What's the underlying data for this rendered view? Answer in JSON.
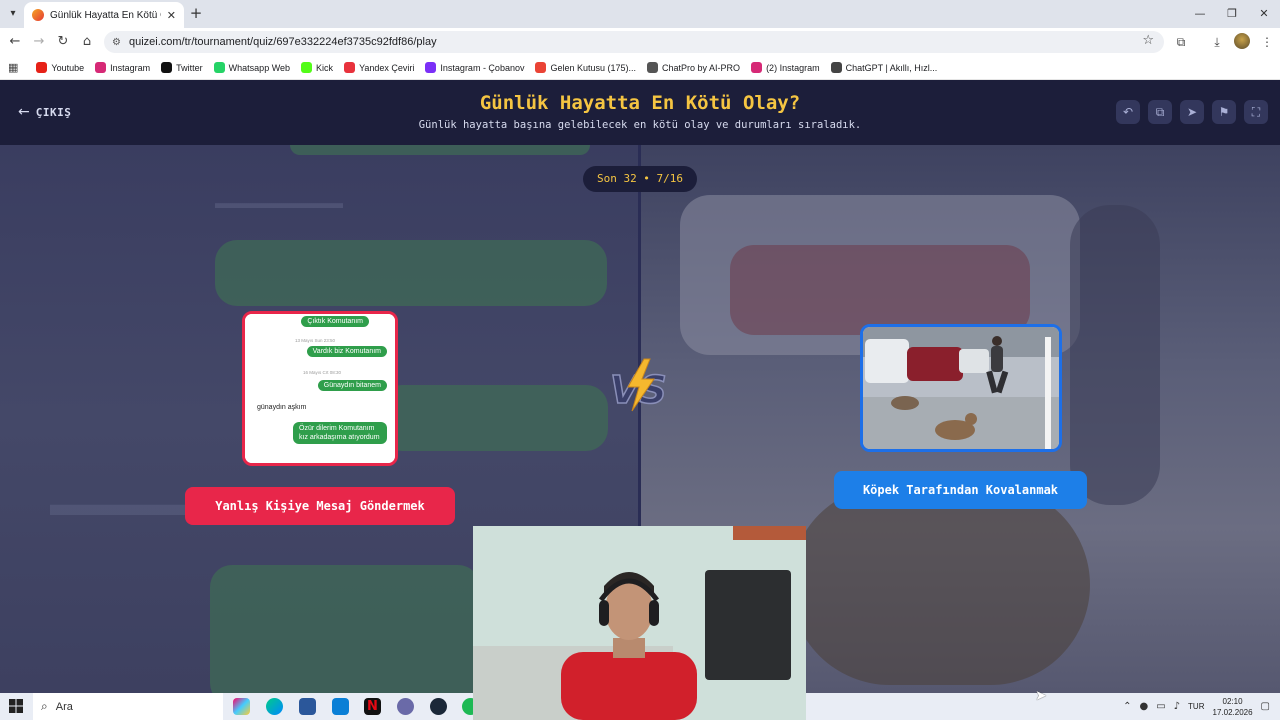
{
  "browser": {
    "tab_title": "Günlük Hayatta En Kötü Olay? -",
    "url": "quizei.com/tr/tournament/quiz/697e332224ef3735c92fdf86/play",
    "bookmarks": [
      {
        "label": "Youtube",
        "color": "#e62117"
      },
      {
        "label": "Instagram",
        "color": "#d62976"
      },
      {
        "label": "Twitter",
        "color": "#111111"
      },
      {
        "label": "Whatsapp Web",
        "color": "#25d366"
      },
      {
        "label": "Kick",
        "color": "#53fc18"
      },
      {
        "label": "Yandex Çeviri",
        "color": "#e8323c"
      },
      {
        "label": "Instagram - Çobanov",
        "color": "#7b2ff7"
      },
      {
        "label": "Gelen Kutusu (175)...",
        "color": "#ea4335"
      },
      {
        "label": "ChatPro by AI-PRO",
        "color": "#555555"
      },
      {
        "label": "(2) Instagram",
        "color": "#d62976"
      },
      {
        "label": "ChatGPT | Akıllı, Hızl...",
        "color": "#444444"
      }
    ]
  },
  "header": {
    "exit_label": "ÇIKIŞ",
    "title": "Günlük Hayatta En Kötü Olay?",
    "subtitle": "Günlük hayatta başına gelebilecek en kötü olay ve durumları sıraladık."
  },
  "round": {
    "label": "Son 32 • 7/16"
  },
  "left_choice": {
    "label": "Yanlış Kişiye Mesaj Göndermek",
    "color": "#e8264a",
    "chat": {
      "msg1": "Çıktık Komutanım",
      "date1": "13 Mayıs Sun 23:50",
      "msg2": "Vardık biz Komutanım",
      "date2": "16 Mayıs Crt 08:30",
      "msg3": "Günaydın bitanem",
      "incoming": "günaydın aşkım",
      "msg4": "Özür dilerim Komutanım kız arkadaşıma atıyordum"
    }
  },
  "right_choice": {
    "label": "Köpek Tarafından Kovalanmak",
    "color": "#1d7fe8"
  },
  "taskbar": {
    "search_placeholder": "Ara",
    "language": "TUR",
    "time": "02:10",
    "date": "17.02.2026"
  }
}
